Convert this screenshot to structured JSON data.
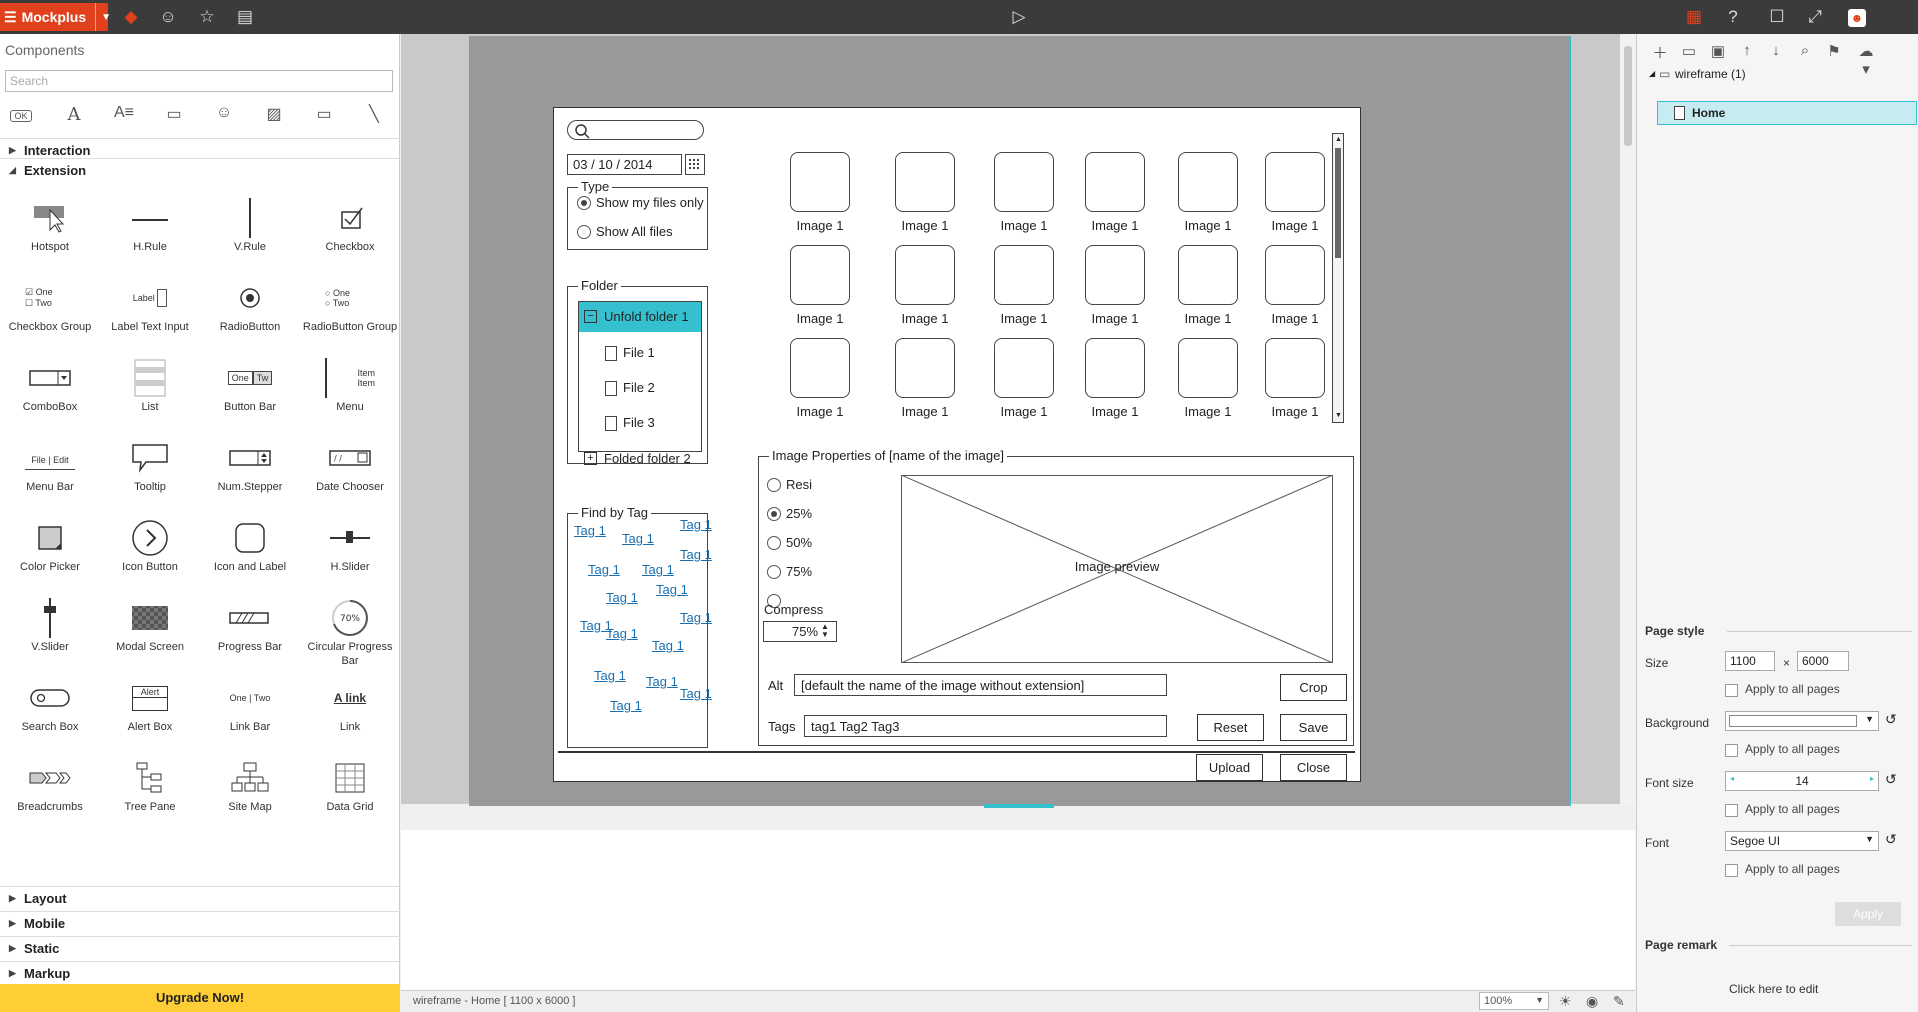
{
  "app": {
    "brand": "Mockplus"
  },
  "left_panel": {
    "title": "Components",
    "search_placeholder": "Search",
    "sections": {
      "interaction": "Interaction",
      "extension": "Extension",
      "layout": "Layout",
      "mobile": "Mobile",
      "static": "Static",
      "markup": "Markup"
    },
    "components": [
      "Hotspot",
      "H.Rule",
      "V.Rule",
      "Checkbox",
      "Checkbox Group",
      "Label Text Input",
      "RadioButton",
      "RadioButton Group",
      "ComboBox",
      "List",
      "Button Bar",
      "Menu",
      "Menu Bar",
      "Tooltip",
      "Num.Stepper",
      "Date Chooser",
      "Color Picker",
      "Icon Button",
      "Icon and Label",
      "H.Slider",
      "V.Slider",
      "Modal Screen",
      "Progress Bar",
      "Circular Progress Bar",
      "Search Box",
      "Alert Box",
      "Link Bar",
      "Link",
      "Breadcrumbs",
      "Tree Pane",
      "Site Map",
      "Data Grid"
    ],
    "icon_text": {
      "one": "One",
      "two": "Two",
      "label": "Label",
      "tw": "Tw",
      "item": "Item",
      "file_edit": "File | Edit",
      "alert": "Alert",
      "pct": "70%",
      "one_two": "One | Two",
      "a_link": "A link"
    },
    "upgrade": "Upgrade Now!"
  },
  "wireframe": {
    "date_value": "03 / 10 / 2014",
    "type_legend": "Type",
    "type_options": [
      "Show my files only",
      "Show All files"
    ],
    "folder_legend": "Folder",
    "folder_items": [
      "Unfold folder 1",
      "File 1",
      "File 2",
      "File 3",
      "Folded folder 2"
    ],
    "tag_legend": "Find by Tag",
    "tag_label": "Tag 1",
    "image_label": "Image 1",
    "props_legend": "Image Properties  of [name of the image]",
    "resize_options": [
      "Resi",
      "25%",
      "50%",
      "75%"
    ],
    "compress_label": "Compress",
    "compress_value": "75%",
    "preview_label": "Image preview",
    "alt_label": "Alt",
    "alt_value": "[default the name of the image without extension]",
    "tags_label": "Tags",
    "tags_value": "tag1 Tag2 Tag3",
    "buttons": {
      "crop": "Crop",
      "reset": "Reset",
      "save": "Save",
      "upload": "Upload",
      "close": "Close"
    }
  },
  "right_panel": {
    "tree_root": "wireframe (1)",
    "tree_page": "Home",
    "page_style_title": "Page style",
    "size_label": "Size",
    "size_w": "1100",
    "size_x": "×",
    "size_h": "6000",
    "apply_all": "Apply to all pages",
    "background_label": "Background",
    "font_size_label": "Font size",
    "font_size_value": "14",
    "font_label": "Font",
    "font_value": "Segoe UI",
    "apply_button": "Apply",
    "page_remark_title": "Page remark",
    "remark_hint": "Click here to edit"
  },
  "status": {
    "path": "wireframe - Home [ 1100 x 6000 ]",
    "zoom": "100%"
  }
}
